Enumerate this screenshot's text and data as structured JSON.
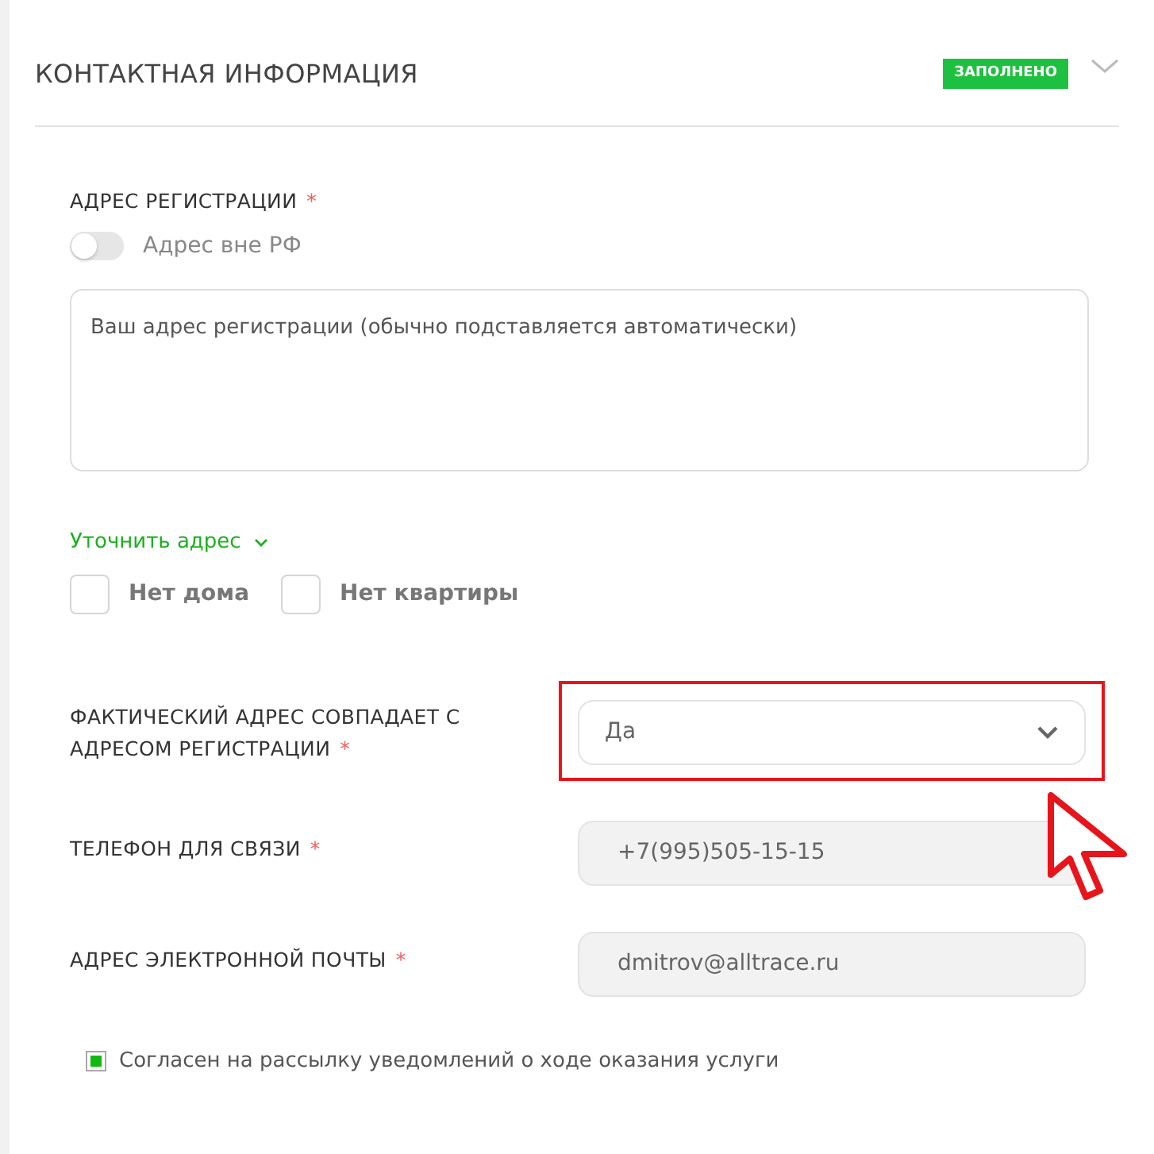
{
  "section": {
    "title": "КОНТАКТНАЯ ИНФОРМАЦИЯ",
    "status": "ЗАПОЛНЕНО",
    "expanded": true
  },
  "registration": {
    "label": "АДРЕС РЕГИСТРАЦИИ",
    "required_mark": "*",
    "toggle": {
      "label": "Адрес вне РФ",
      "on": false
    },
    "address": {
      "placeholder": "Ваш адрес регистрации (обычно подставляется автоматически)"
    },
    "refine_link": "Уточнить адрес",
    "options": [
      {
        "label": "Нет дома",
        "checked": false
      },
      {
        "label": "Нет квартиры",
        "checked": false
      }
    ]
  },
  "fields": [
    {
      "kind": "select",
      "label": "ФАКТИЧЕСКИЙ АДРЕС СОВПАДАЕТ С АДРЕСОМ РЕГИСТРАЦИИ",
      "required_mark": "*",
      "value": "Да",
      "highlighted": true
    },
    {
      "kind": "input",
      "label": "ТЕЛЕФОН ДЛЯ СВЯЗИ",
      "required_mark": "*",
      "value": "+7(995)505-15-15",
      "highlighted": false
    },
    {
      "kind": "input",
      "label": "АДРЕС ЭЛЕКТРОННОЙ ПОЧТЫ",
      "required_mark": "*",
      "value": "dmitrov@alltrace.ru",
      "highlighted": false
    }
  ],
  "consent": {
    "label": "Согласен на рассылку уведомлений о ходе оказания услуги",
    "checked": true
  },
  "pointer_shown": true
}
